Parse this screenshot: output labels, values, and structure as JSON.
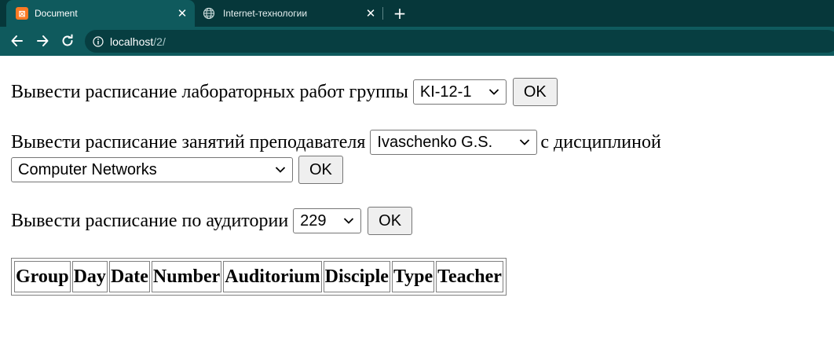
{
  "browser": {
    "tabs": [
      {
        "title": "Document",
        "active": true,
        "icon": "xampp-icon"
      },
      {
        "title": "Internet-технологии",
        "active": false,
        "icon": "globe-icon"
      }
    ],
    "url": {
      "host": "localhost",
      "path": "/2/"
    }
  },
  "form": {
    "labs": {
      "label": "Вывести расписание лабораторных работ группы",
      "group_value": "KI-12-1",
      "button": "OK"
    },
    "teacher": {
      "label": "Вывести расписание занятий преподавателя",
      "teacher_value": "Ivaschenko G.S.",
      "label2": "с дисциплиной",
      "discipline_value": "Computer Networks",
      "button": "OK"
    },
    "room": {
      "label": "Вывести расписание по аудитории",
      "room_value": "229",
      "button": "OK"
    }
  },
  "table": {
    "headers": [
      "Group",
      "Day",
      "Date",
      "Number",
      "Auditorium",
      "Disciple",
      "Type",
      "Teacher"
    ]
  },
  "colors": {
    "tabstrip": "#06373a",
    "toolbar": "#0f5a5d",
    "xampp": "#fb7a24"
  }
}
